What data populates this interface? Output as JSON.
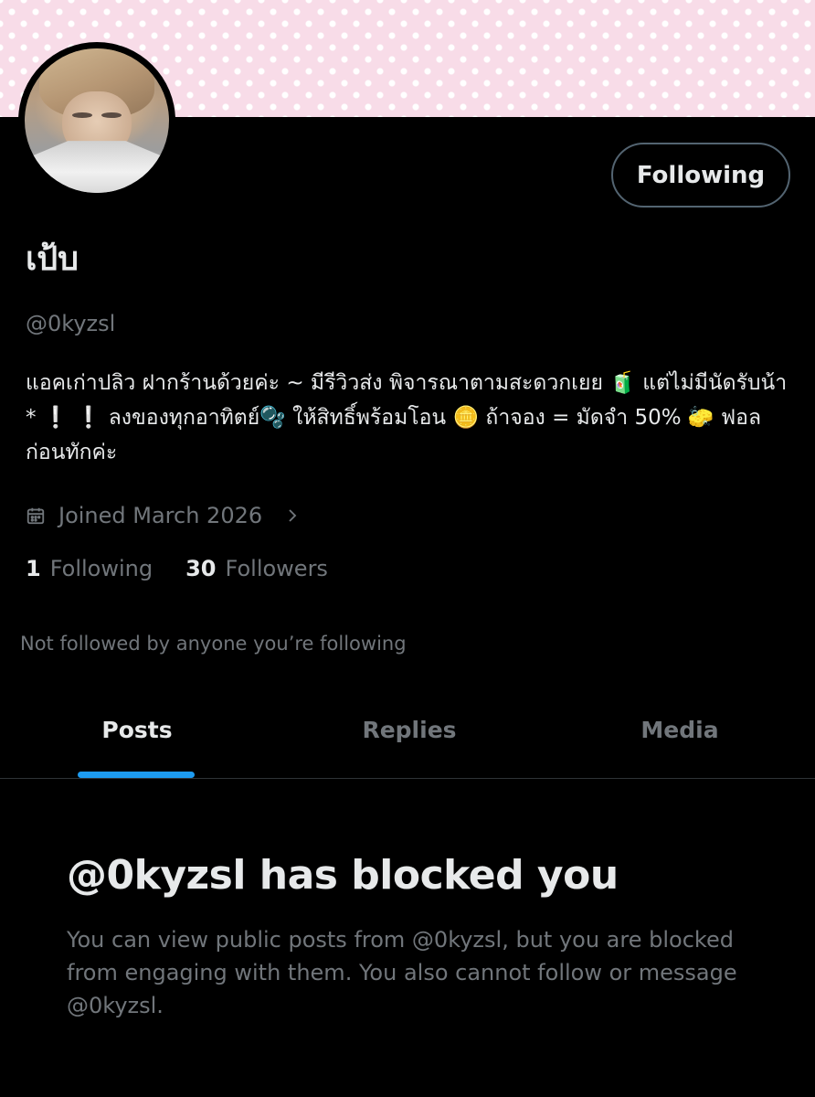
{
  "profile": {
    "display_name": "เป้บ",
    "handle": "@0kyzsl",
    "bio": "แอคเก่าปลิว ฝากร้านด้วยค่ะ ~ มีรีวิวส่ง พิจารณาตามสะดวกเยย 🧃 แต่ไม่มีนัดรับน้า * ❕ ❕ ลงของทุกอาทิตย์🫧 ให้สิทธิ์พร้อมโอน 🪙 ถ้าจอง = มัดจำ 50% 🧽 ฟอลก่อนทักค่ะ",
    "joined": "Joined March 2026",
    "following_count": "1",
    "following_label": "Following",
    "followers_count": "30",
    "followers_label": "Followers",
    "not_followed_text": "Not followed by anyone you’re following"
  },
  "actions": {
    "follow_button_label": "Following"
  },
  "tabs": [
    {
      "label": "Posts",
      "active": true
    },
    {
      "label": "Replies",
      "active": false
    },
    {
      "label": "Media",
      "active": false
    }
  ],
  "blocked": {
    "title": "@0kyzsl has blocked you",
    "message": "You can view public posts from @0kyzsl, but you are blocked from engaging with them. You also cannot follow or message @0kyzsl."
  },
  "colors": {
    "background": "#000000",
    "banner": "#f8dce8",
    "accent": "#1d9bf0",
    "muted_text": "#71767b",
    "primary_text": "#e7e9ea"
  },
  "icons": [
    "calendar-icon",
    "chevron-right-icon"
  ]
}
